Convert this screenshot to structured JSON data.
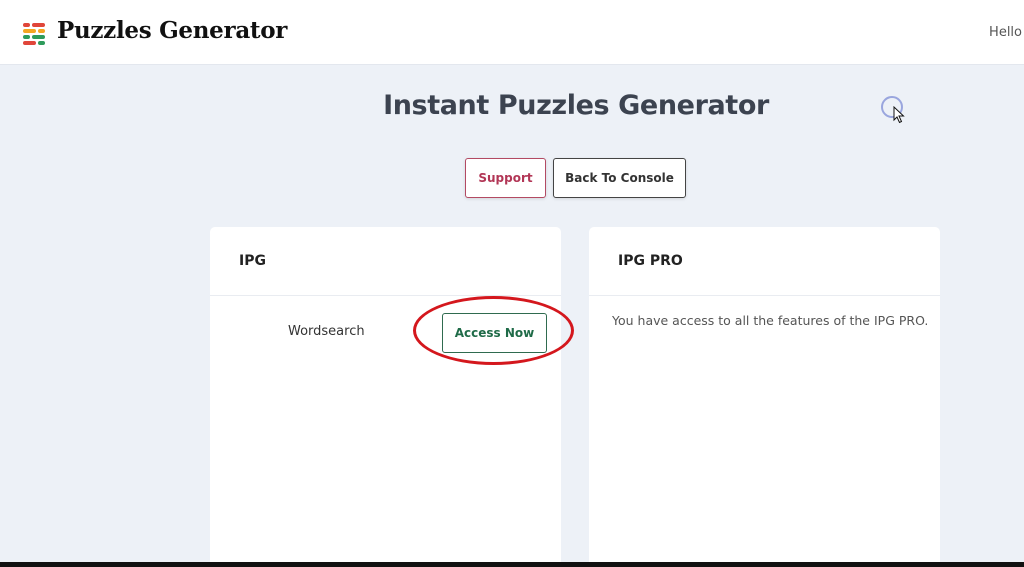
{
  "header": {
    "brand": "Puzzles Generator",
    "greeting": "Hello",
    "logo_colors": [
      "#e0463a",
      "#f5a623",
      "#2e9b5b",
      "#e0463a"
    ]
  },
  "main": {
    "title": "Instant Puzzles Generator",
    "support_label": "Support",
    "console_label": "Back To Console"
  },
  "cards": {
    "ipg": {
      "title": "IPG",
      "item_name": "Wordsearch",
      "action_label": "Access Now"
    },
    "pro": {
      "title": "IPG PRO",
      "text": "You have access to all the features of the IPG PRO."
    }
  },
  "icons": [
    "logo-icon",
    "loading-spinner-icon",
    "mouse-cursor-icon"
  ],
  "colors": {
    "background": "#edf1f7",
    "support_accent": "#b23656",
    "access_accent": "#1f6b48",
    "annotation": "#d4171d"
  }
}
